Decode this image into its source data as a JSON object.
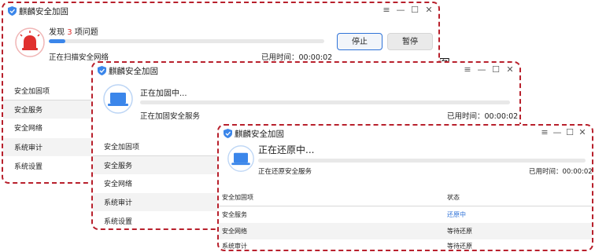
{
  "colors": {
    "accent": "#3b86ea",
    "danger": "#e0302e",
    "border": "#b8202c",
    "status_link": "#2f73d8"
  },
  "window1": {
    "title": "麒麟安全加固",
    "controls": [
      "≡",
      "—",
      "☐",
      "✕"
    ],
    "issue_prefix": "发现",
    "issue_count": "3",
    "issue_suffix": "项问题",
    "progress": 0.06,
    "scanning_text": "正在扫描安全网络",
    "elapsed_label": "已用时间：",
    "elapsed_value": "00:00:02",
    "stop_label": "停止",
    "pause_label": "暂停",
    "list": [
      "安全加固项",
      "安全服务",
      "安全网络",
      "系统审计",
      "系统设置"
    ]
  },
  "window2": {
    "title": "麒麟安全加固",
    "controls": [
      "≡",
      "—",
      "☐",
      "✕"
    ],
    "heading": "正在加固中...",
    "progress": 0.0,
    "status_text": "正在加固安全服务",
    "elapsed_label": "已用时间：",
    "elapsed_value": "00:00:02",
    "list": [
      "安全加固项",
      "安全服务",
      "安全网络",
      "系统审计",
      "系统设置"
    ]
  },
  "window3": {
    "title": "麒麟安全加固",
    "controls": [
      "≡",
      "—",
      "☐",
      "✕"
    ],
    "heading": "正在还原中...",
    "progress": 0.0,
    "status_text": "正在还原安全服务",
    "elapsed_label": "已用时间：",
    "elapsed_value": "00:00:02",
    "table_header": {
      "item": "安全加固项",
      "state": "状态"
    },
    "rows": [
      {
        "item": "安全服务",
        "state": "还原中"
      },
      {
        "item": "安全网络",
        "state": "等待还原"
      },
      {
        "item": "系统审计",
        "state": "等待还原"
      }
    ]
  },
  "stray_glyph": "图"
}
